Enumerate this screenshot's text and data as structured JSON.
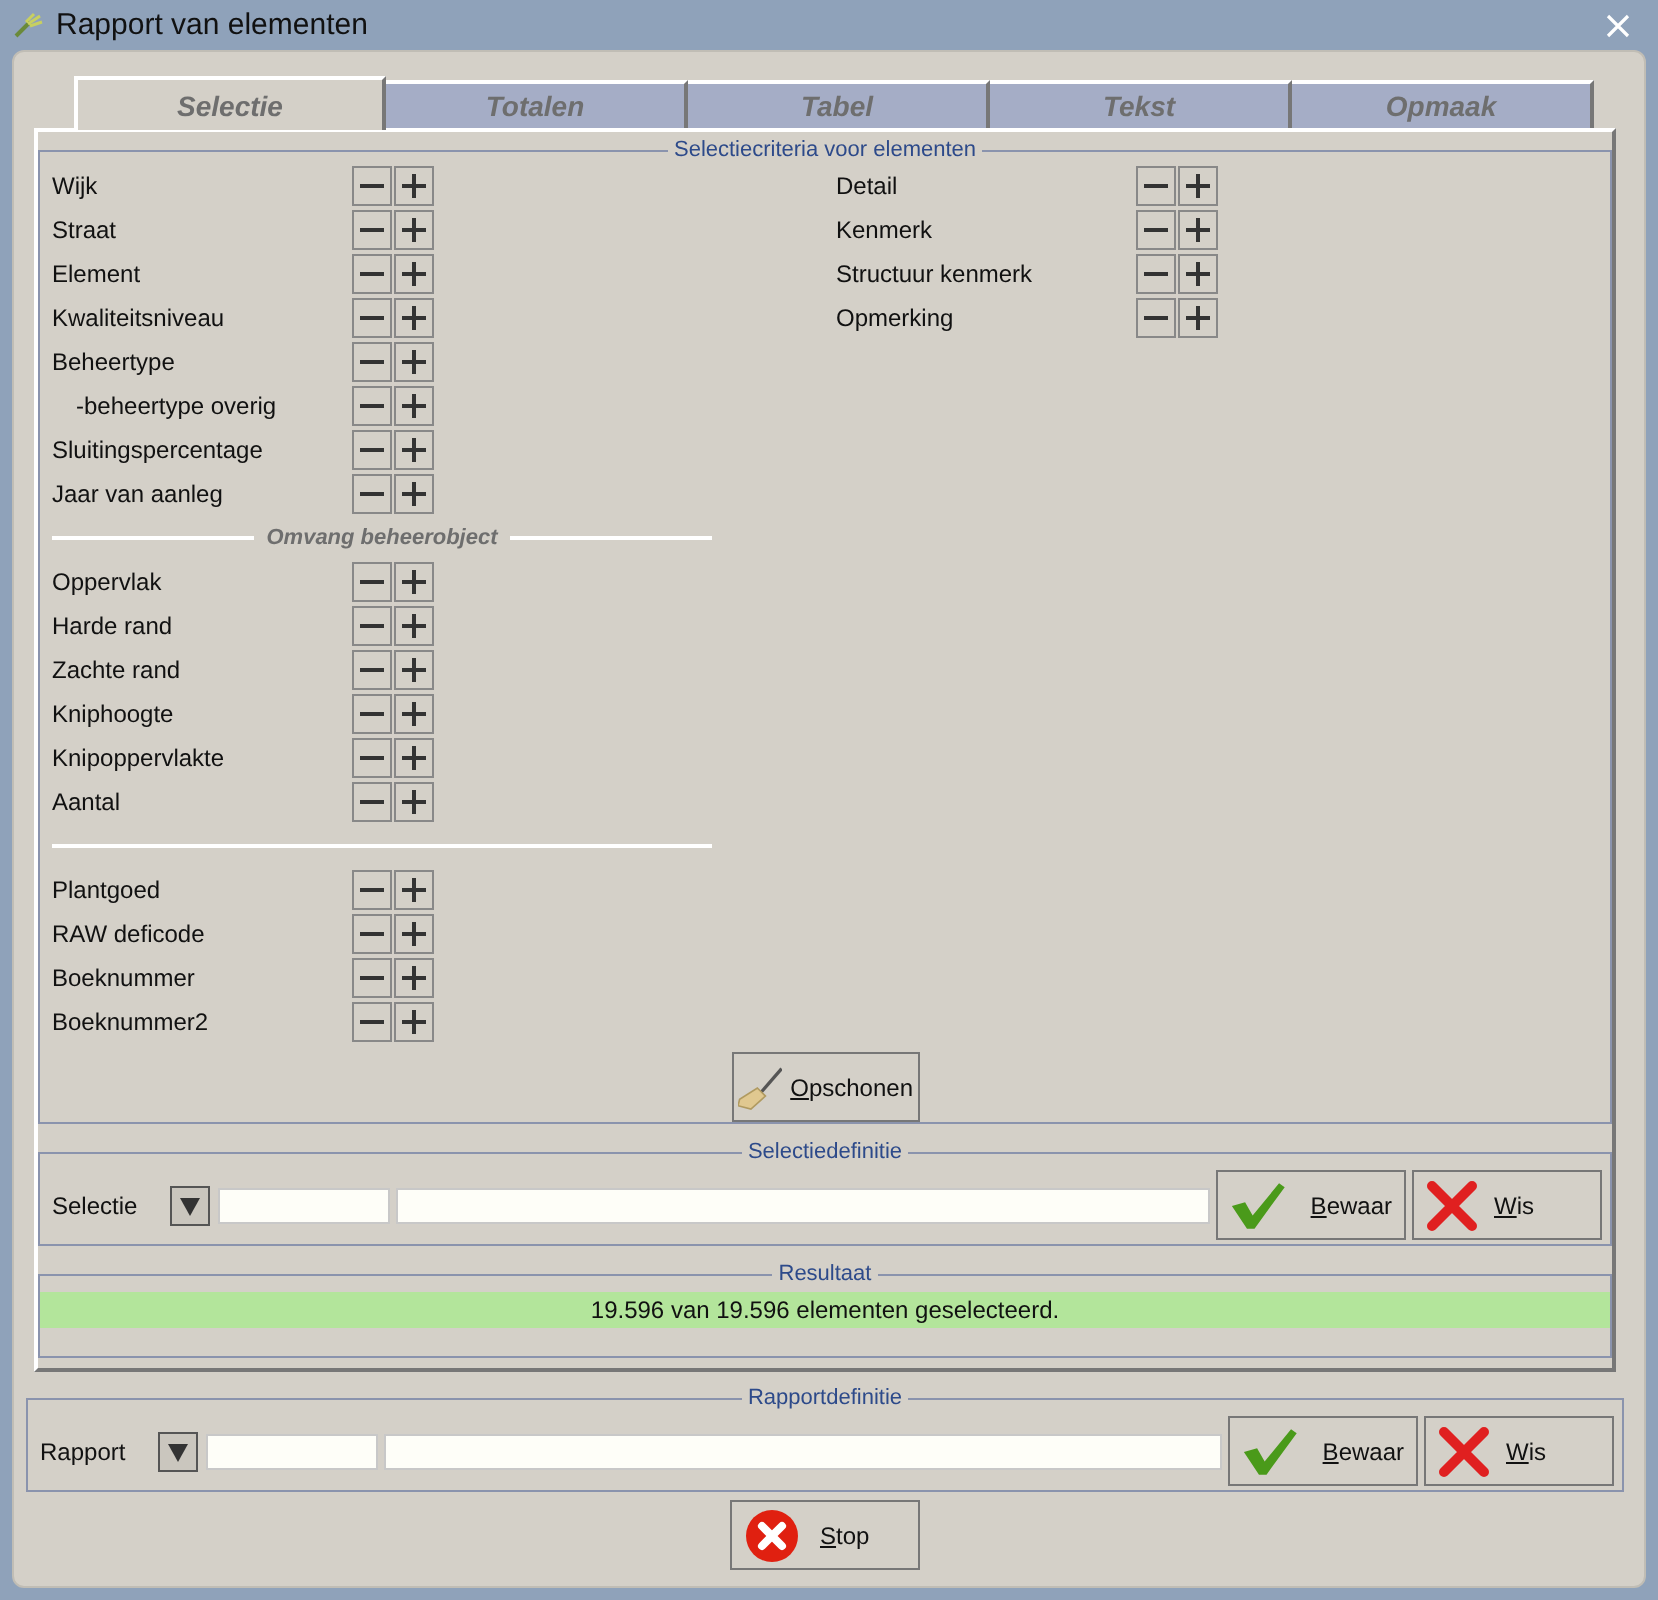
{
  "window": {
    "title": "Rapport van elementen"
  },
  "tabs": [
    {
      "label": "Selectie",
      "selected": true
    },
    {
      "label": "Totalen",
      "selected": false
    },
    {
      "label": "Tabel",
      "selected": false
    },
    {
      "label": "Tekst",
      "selected": false
    },
    {
      "label": "Opmaak",
      "selected": false
    }
  ],
  "criteria": {
    "legend": "Selectiecriteria voor elementen",
    "left_column": [
      {
        "kind": "row",
        "label": "Wijk"
      },
      {
        "kind": "row",
        "label": "Straat"
      },
      {
        "kind": "row",
        "label": "Element"
      },
      {
        "kind": "row",
        "label": "Kwaliteitsniveau"
      },
      {
        "kind": "row",
        "label": "Beheertype",
        "children": [
          {
            "kind": "row",
            "label": "-beheertype overig"
          }
        ]
      },
      {
        "kind": "row",
        "label": "Sluitingspercentage"
      },
      {
        "kind": "row",
        "label": "Jaar van aanleg"
      },
      {
        "kind": "heading",
        "label": "Omvang beheerobject"
      },
      {
        "kind": "row",
        "label": "Oppervlak"
      },
      {
        "kind": "row",
        "label": "Harde rand"
      },
      {
        "kind": "row",
        "label": "Zachte rand"
      },
      {
        "kind": "row",
        "label": "Kniphoogte"
      },
      {
        "kind": "row",
        "label": "Knipoppervlakte"
      },
      {
        "kind": "row",
        "label": "Aantal"
      },
      {
        "kind": "rule"
      },
      {
        "kind": "row",
        "label": "Plantgoed"
      },
      {
        "kind": "row",
        "label": "RAW deficode"
      },
      {
        "kind": "row",
        "label": "Boeknummer"
      },
      {
        "kind": "row",
        "label": "Boeknummer2"
      }
    ],
    "right_column": [
      {
        "kind": "row",
        "label": "Detail"
      },
      {
        "kind": "row",
        "label": "Kenmerk"
      },
      {
        "kind": "row",
        "label": "Structuur kenmerk"
      },
      {
        "kind": "row",
        "label": "Opmerking"
      }
    ],
    "clear_button": "Opschonen"
  },
  "selection_definition": {
    "legend": "Selectiedefinitie",
    "label": "Selectie",
    "save_button": "Bewaar",
    "delete_button": "Wis"
  },
  "result": {
    "legend": "Resultaat",
    "message": "19.596 van 19.596 elementen geselecteerd."
  },
  "report_definition": {
    "legend": "Rapportdefinitie",
    "label": "Rapport",
    "save_button": "Bewaar",
    "delete_button": "Wis"
  },
  "stop_button": "Stop"
}
